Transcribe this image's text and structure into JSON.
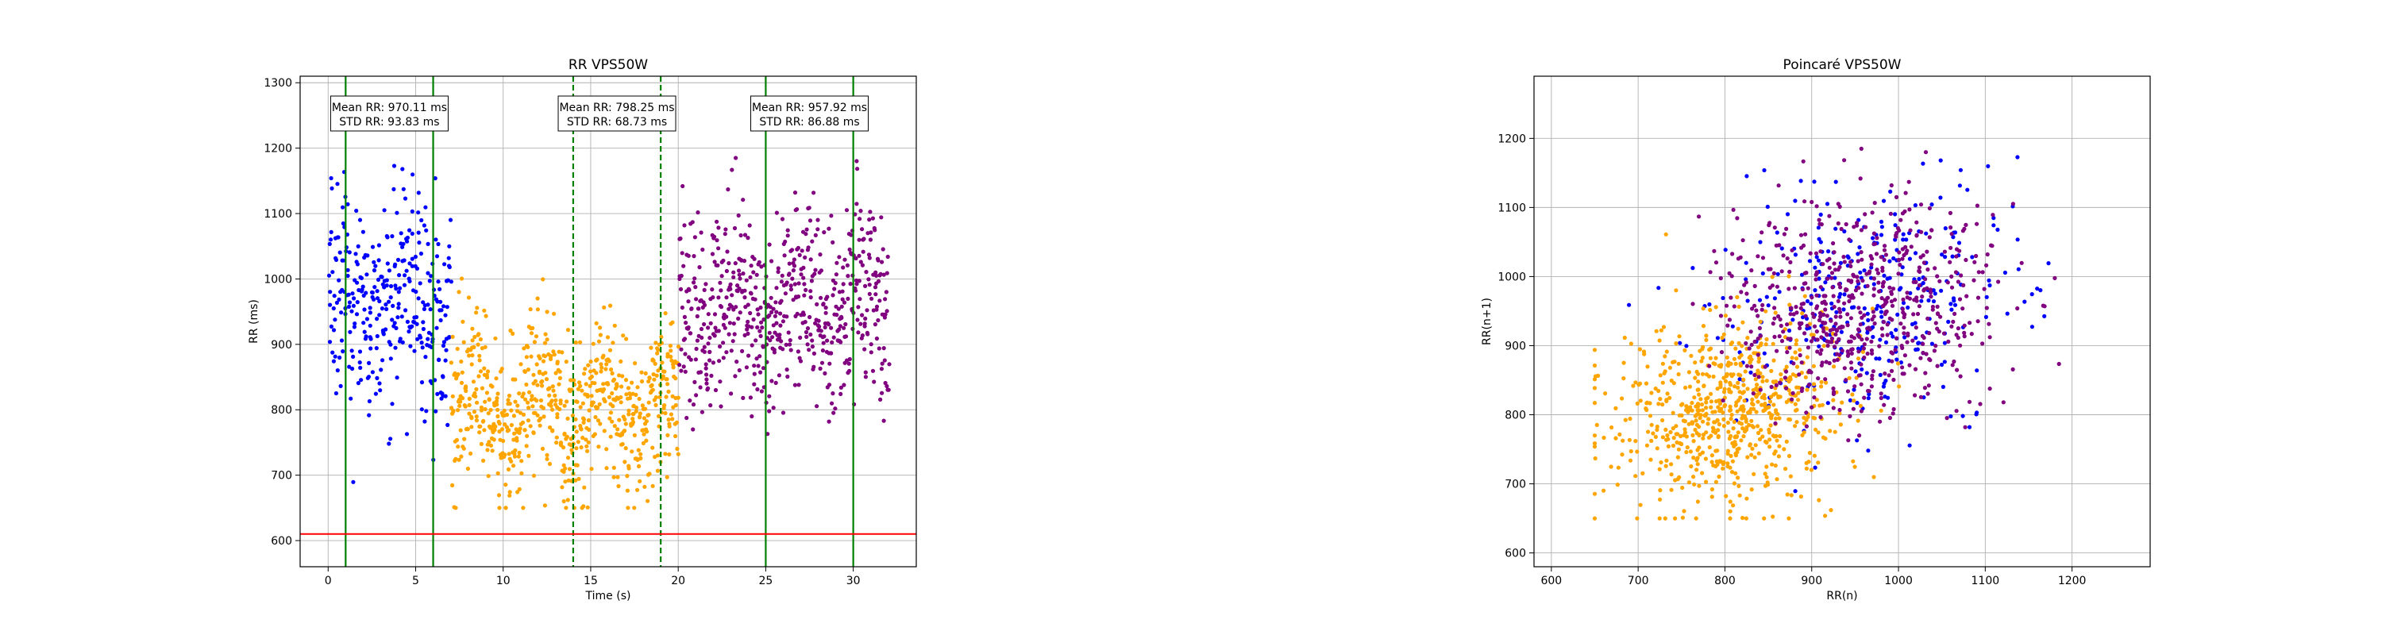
{
  "chart_data": [
    {
      "type": "scatter",
      "title": "RR VPS50W",
      "xlabel": "Time (s)",
      "ylabel": "RR (ms)",
      "xlim": [
        -1.6,
        33.6
      ],
      "ylim": [
        560,
        1310
      ],
      "xticks": [
        0,
        5,
        10,
        15,
        20,
        25,
        30
      ],
      "yticks": [
        600,
        700,
        800,
        900,
        1000,
        1100,
        1200,
        1300
      ],
      "grid": true,
      "colors": {
        "blue": "#0000ff",
        "orange": "#ffa500",
        "purple": "#800080",
        "green": "#008000",
        "red": "#ff0000"
      },
      "series": [
        {
          "color": "#0000ff",
          "x_range": [
            0,
            7
          ],
          "mean": 970.11,
          "std": 93.83
        },
        {
          "color": "#ffa500",
          "x_range": [
            7,
            20
          ],
          "mean": 798.25,
          "std": 68.73
        },
        {
          "color": "#800080",
          "x_range": [
            20,
            32
          ],
          "mean": 957.92,
          "std": 86.88
        }
      ],
      "vlines": [
        {
          "x": 1,
          "style": "solid",
          "color": "#008000"
        },
        {
          "x": 6,
          "style": "solid",
          "color": "#008000"
        },
        {
          "x": 14,
          "style": "dashed",
          "color": "#008000"
        },
        {
          "x": 19,
          "style": "dashed",
          "color": "#008000"
        },
        {
          "x": 25,
          "style": "solid",
          "color": "#008000"
        },
        {
          "x": 30,
          "style": "solid",
          "color": "#008000"
        }
      ],
      "hline": {
        "y": 610,
        "color": "#ff0000"
      },
      "annotations": [
        {
          "x": 3.5,
          "line1": "Mean RR: 970.11 ms",
          "line2": "STD RR: 93.83 ms"
        },
        {
          "x": 16.5,
          "line1": "Mean RR: 798.25 ms",
          "line2": "STD RR: 68.73 ms"
        },
        {
          "x": 27.5,
          "line1": "Mean RR: 957.92 ms",
          "line2": "STD RR: 86.88 ms"
        }
      ]
    },
    {
      "type": "scatter",
      "title": "Poincaré VPS50W",
      "xlabel": "RR(n)",
      "ylabel": "RR(n+1)",
      "xlim": [
        580,
        1290
      ],
      "ylim": [
        580,
        1290
      ],
      "xticks": [
        600,
        700,
        800,
        900,
        1000,
        1100,
        1200
      ],
      "yticks": [
        600,
        700,
        800,
        900,
        1000,
        1100,
        1200
      ],
      "grid": true,
      "series": [
        {
          "color": "#0000ff",
          "mean": 970.11,
          "std": 93.83
        },
        {
          "color": "#ffa500",
          "mean": 798.25,
          "std": 68.73
        },
        {
          "color": "#800080",
          "mean": 957.92,
          "std": 86.88
        }
      ]
    }
  ]
}
